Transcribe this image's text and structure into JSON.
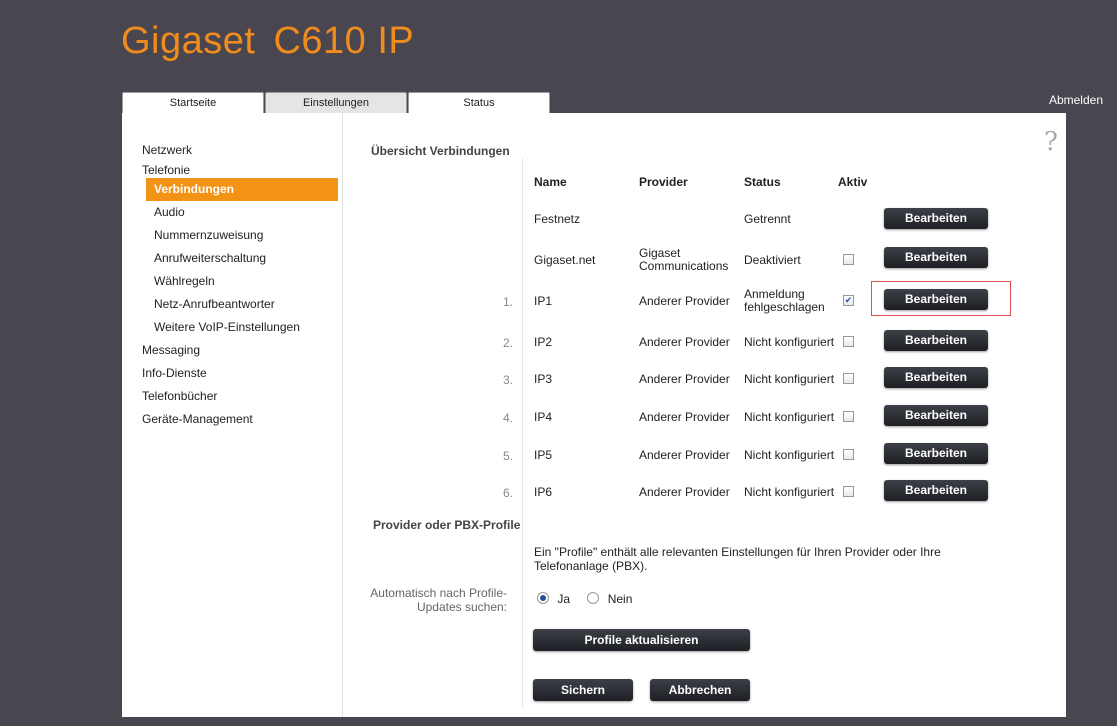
{
  "brand": {
    "name": "Gigaset",
    "model": "C610 IP"
  },
  "tabs": [
    {
      "label": "Startseite"
    },
    {
      "label": "Einstellungen"
    },
    {
      "label": "Status"
    }
  ],
  "logout": "Abmelden",
  "help": "?",
  "sidebar": {
    "items": [
      {
        "label": "Netzwerk"
      },
      {
        "label": "Telefonie"
      },
      {
        "label": "Verbindungen"
      },
      {
        "label": "Audio"
      },
      {
        "label": "Nummernzuweisung"
      },
      {
        "label": "Anrufweiterschaltung"
      },
      {
        "label": "Wählregeln"
      },
      {
        "label": "Netz-Anrufbeantworter"
      },
      {
        "label": "Weitere VoIP-Einstellungen"
      },
      {
        "label": "Messaging"
      },
      {
        "label": "Info-Dienste"
      },
      {
        "label": "Telefonbücher"
      },
      {
        "label": "Geräte-Management"
      }
    ]
  },
  "connections": {
    "title": "Übersicht Verbindungen",
    "columns": [
      "Name",
      "Provider",
      "Status",
      "Aktiv"
    ],
    "edit_label": "Bearbeiten",
    "rows": [
      {
        "num": "",
        "name": "Festnetz",
        "provider": "",
        "status": "Getrennt",
        "active": null
      },
      {
        "num": "",
        "name": "Gigaset.net",
        "provider": "Gigaset Communications",
        "status": "Deaktiviert",
        "active": false
      },
      {
        "num": "1.",
        "name": "IP1",
        "provider": "Anderer Provider",
        "status": "Anmeldung fehlgeschlagen",
        "active": true
      },
      {
        "num": "2.",
        "name": "IP2",
        "provider": "Anderer Provider",
        "status": "Nicht konfiguriert",
        "active": false
      },
      {
        "num": "3.",
        "name": "IP3",
        "provider": "Anderer Provider",
        "status": "Nicht konfiguriert",
        "active": false
      },
      {
        "num": "4.",
        "name": "IP4",
        "provider": "Anderer Provider",
        "status": "Nicht konfiguriert",
        "active": false
      },
      {
        "num": "5.",
        "name": "IP5",
        "provider": "Anderer Provider",
        "status": "Nicht konfiguriert",
        "active": false
      },
      {
        "num": "6.",
        "name": "IP6",
        "provider": "Anderer Provider",
        "status": "Nicht konfiguriert",
        "active": false
      }
    ]
  },
  "profiles": {
    "title": "Provider oder PBX-Profile",
    "description": "Ein \"Profile\" enthält alle relevanten Einstellungen für Ihren Provider oder Ihre Telefonanlage (PBX).",
    "auto_label": "Automatisch nach Profile-Updates suchen:",
    "option_yes": "Ja",
    "option_no": "Nein",
    "selected": "Ja",
    "update_button": "Profile aktualisieren"
  },
  "actions": {
    "save": "Sichern",
    "cancel": "Abbrechen"
  },
  "colors": {
    "accent": "#f39315",
    "brand": "#f08c1c",
    "background": "#4a4650",
    "button": "#2a2c32"
  }
}
